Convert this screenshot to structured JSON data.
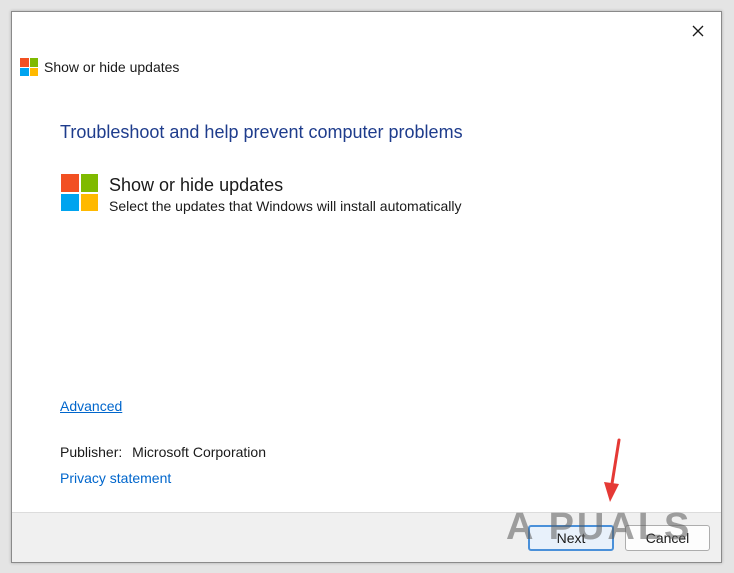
{
  "window": {
    "title": "Show or hide updates",
    "close_icon": "close-icon"
  },
  "content": {
    "headline": "Troubleshoot and help prevent computer problems",
    "task_title": "Show or hide updates",
    "task_description": "Select the updates that Windows will install automatically",
    "advanced_link": "Advanced",
    "publisher_label": "Publisher:",
    "publisher_value": "Microsoft Corporation",
    "privacy_link": "Privacy statement"
  },
  "footer": {
    "next_label": "Next",
    "cancel_label": "Cancel"
  },
  "watermark": {
    "text": "A PUALS"
  },
  "colors": {
    "headline": "#1e3c8c",
    "link": "#0066cc",
    "annotation_arrow": "#e53935",
    "logo_red": "#f25022",
    "logo_green": "#7fba00",
    "logo_blue": "#00a4ef",
    "logo_yellow": "#ffb900"
  }
}
